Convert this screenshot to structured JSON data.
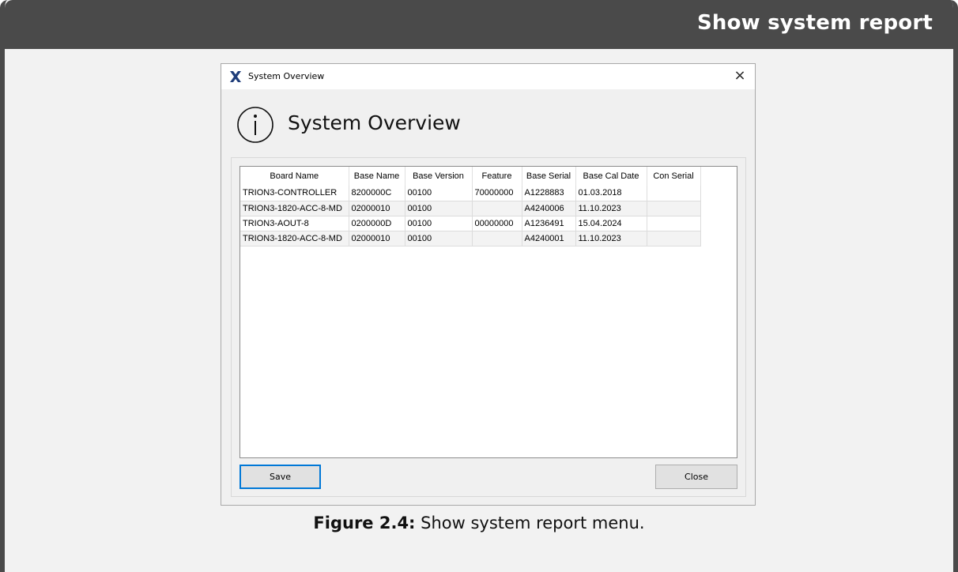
{
  "banner": {
    "title": "Show system report"
  },
  "dialog": {
    "window_title": "System Overview",
    "heading": "System Overview",
    "table": {
      "headers": [
        "Board Name",
        "Base Name",
        "Base Version",
        "Feature",
        "Base Serial",
        "Base Cal Date",
        "Con Serial"
      ],
      "rows": [
        [
          "TRION3-CONTROLLER",
          "8200000C",
          "00100",
          "70000000",
          "A1228883",
          "01.03.2018",
          ""
        ],
        [
          "TRION3-1820-ACC-8-MD",
          "02000010",
          "00100",
          "",
          "A4240006",
          "11.10.2023",
          ""
        ],
        [
          "TRION3-AOUT-8",
          "0200000D",
          "00100",
          "00000000",
          "A1236491",
          "15.04.2024",
          ""
        ],
        [
          "TRION3-1820-ACC-8-MD",
          "02000010",
          "00100",
          "",
          "A4240001",
          "11.10.2023",
          ""
        ]
      ]
    },
    "buttons": {
      "save": "Save",
      "close": "Close"
    },
    "close_glyph": "×"
  },
  "caption": {
    "label": "Figure 2.4:",
    "text": "Show system report menu."
  },
  "colors": {
    "banner": "#4a4a4a",
    "focus_border": "#0078d7",
    "app_icon": "#1f3d7a"
  },
  "icons": {
    "app": "x-logo-icon",
    "info": "info-circle-icon",
    "close": "close-icon"
  }
}
